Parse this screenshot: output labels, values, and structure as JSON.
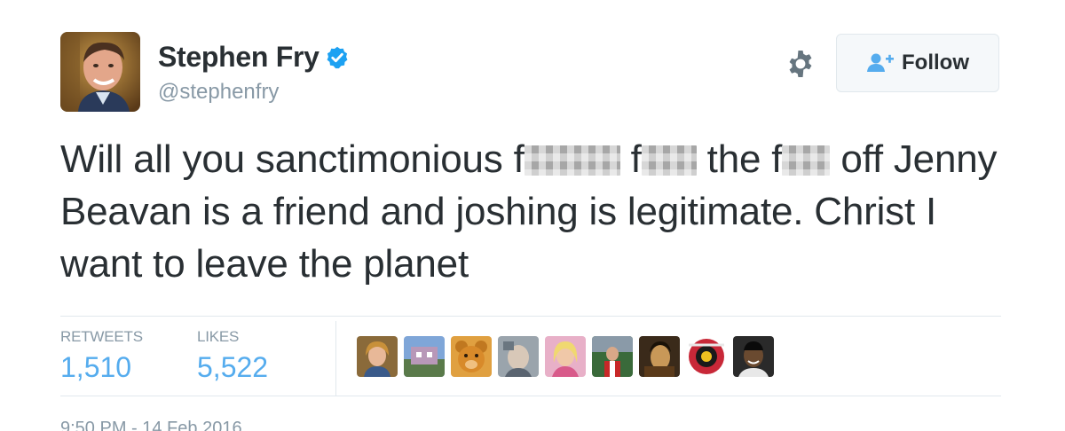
{
  "author": {
    "display_name": "Stephen Fry",
    "handle": "@stephenfry",
    "verified": true,
    "avatar_icon": "profile-photo",
    "verified_color": "#1da1f2"
  },
  "actions": {
    "settings_icon": "gear-icon",
    "follow_label": "Follow",
    "follow_icon": "add-user-icon"
  },
  "tweet": {
    "text_parts": [
      "Will all you sanctimonious f",
      "f",
      " the f",
      "off Jenny Beavan is a friend and joshing is legitimate. Christ I want to leave the planet"
    ]
  },
  "stats": {
    "retweets_label": "RETWEETS",
    "retweets_value": "1,510",
    "likes_label": "LIKES",
    "likes_value": "5,522"
  },
  "likers": [
    {
      "name": "liker-avatar-1"
    },
    {
      "name": "liker-avatar-2"
    },
    {
      "name": "liker-avatar-3"
    },
    {
      "name": "liker-avatar-4"
    },
    {
      "name": "liker-avatar-5"
    },
    {
      "name": "liker-avatar-6"
    },
    {
      "name": "liker-avatar-7"
    },
    {
      "name": "liker-avatar-8"
    },
    {
      "name": "liker-avatar-9"
    }
  ],
  "timestamp": "9:50 PM - 14 Feb 2016",
  "colors": {
    "accent": "#55acee",
    "muted": "#8899a6",
    "text": "#292f33"
  }
}
